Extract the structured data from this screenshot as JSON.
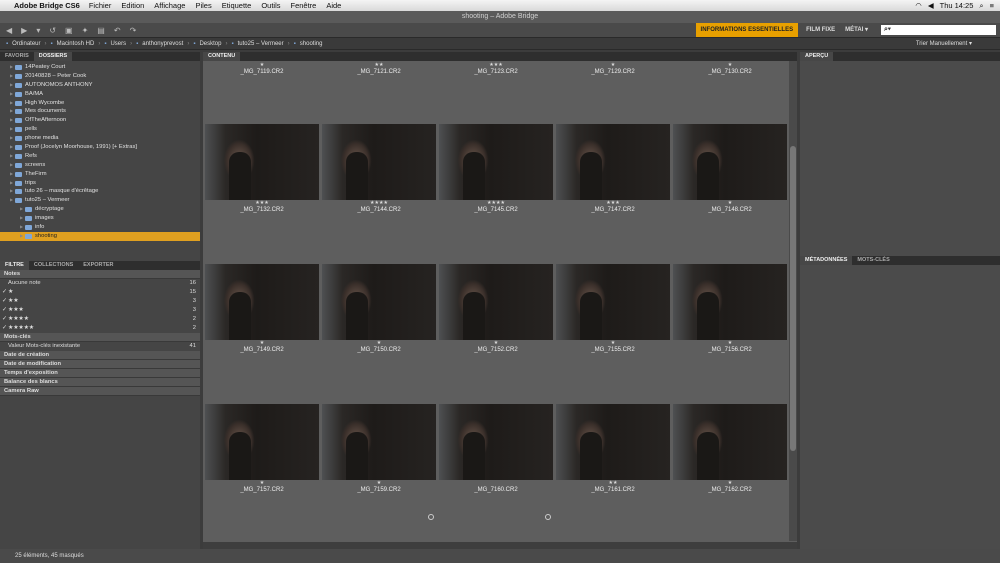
{
  "menubar": {
    "app": "Adobe Bridge CS6",
    "items": [
      "Fichier",
      "Edition",
      "Affichage",
      "Piles",
      "Etiquette",
      "Outils",
      "Fenêtre",
      "Aide"
    ],
    "clock": "Thu 14:25"
  },
  "window": {
    "title": "shooting – Adobe Bridge"
  },
  "workspaces": {
    "active": "INFORMATIONS ESSENTIELLES",
    "film": "FILM FIXE",
    "meta": "MÉTAI ▾",
    "search_placeholder": "⌕▾"
  },
  "path": [
    "Ordinateur",
    "Macintosh HD",
    "Users",
    "anthonyprevost",
    "Desktop",
    "tuto25 – Vermeer",
    "shooting"
  ],
  "sort": "Trier Manuellement ▾",
  "left_tabs": [
    "FAVORIS",
    "DOSSIERS"
  ],
  "folders": [
    {
      "label": "14Peatey Court",
      "depth": 1
    },
    {
      "label": "20140828 – Peter Cook",
      "depth": 1
    },
    {
      "label": "AUTONOMOS ANTHONY",
      "depth": 1
    },
    {
      "label": "BA/MA",
      "depth": 1
    },
    {
      "label": "High Wycombe",
      "depth": 1
    },
    {
      "label": "Mes documents",
      "depth": 1
    },
    {
      "label": "OfTheAfternoon",
      "depth": 1
    },
    {
      "label": "pells",
      "depth": 1
    },
    {
      "label": "phone media",
      "depth": 1
    },
    {
      "label": "Proof (Jocelyn Moorhouse, 1991) [+ Extras]",
      "depth": 1
    },
    {
      "label": "Refs",
      "depth": 1
    },
    {
      "label": "screens",
      "depth": 1
    },
    {
      "label": "TheFirm",
      "depth": 1
    },
    {
      "label": "trips",
      "depth": 1
    },
    {
      "label": "tuto 26 – masque d'écrêtage",
      "depth": 1
    },
    {
      "label": "tuto25 – Vermeer",
      "depth": 1
    },
    {
      "label": "décryptage",
      "depth": 2
    },
    {
      "label": "images",
      "depth": 2
    },
    {
      "label": "info",
      "depth": 2
    },
    {
      "label": "shooting",
      "depth": 2
    }
  ],
  "filter_tabs": [
    "FILTRE",
    "COLLECTIONS",
    "EXPORTER"
  ],
  "filter": {
    "notes_header": "Notes",
    "notes": [
      {
        "label": "Aucune note",
        "count": "16",
        "check": ""
      },
      {
        "label": "★",
        "count": "15",
        "check": "✓"
      },
      {
        "label": "★★",
        "count": "3",
        "check": "✓"
      },
      {
        "label": "★★★",
        "count": "3",
        "check": "✓"
      },
      {
        "label": "★★★★",
        "count": "2",
        "check": "✓"
      },
      {
        "label": "★★★★★",
        "count": "2",
        "check": "✓"
      }
    ],
    "keywords_header": "Mots-clés",
    "keywords": [
      {
        "label": "Valeur Mots-clés inexistante",
        "count": "41"
      }
    ],
    "collapsed": [
      "Date de création",
      "Date de modification",
      "Temps d'exposition",
      "Balance des blancs",
      "Camera Raw"
    ]
  },
  "content_tab": "CONTENU",
  "thumbs_top": [
    {
      "stars": "★",
      "name": "_MG_7119.CR2"
    },
    {
      "stars": "★★",
      "name": "_MG_7121.CR2"
    },
    {
      "stars": "★★★",
      "name": "_MG_7123.CR2"
    },
    {
      "stars": "★",
      "name": "_MG_7129.CR2"
    },
    {
      "stars": "★",
      "name": "_MG_7130.CR2"
    }
  ],
  "thumbs": [
    {
      "stars": "★★★",
      "name": "_MG_7132.CR2"
    },
    {
      "stars": "★★★★",
      "name": "_MG_7144.CR2"
    },
    {
      "stars": "★★★★",
      "name": "_MG_7145.CR2"
    },
    {
      "stars": "★★★",
      "name": "_MG_7147.CR2"
    },
    {
      "stars": "★",
      "name": "_MG_7148.CR2"
    },
    {
      "stars": "★",
      "name": "_MG_7149.CR2"
    },
    {
      "stars": "★",
      "name": "_MG_7150.CR2"
    },
    {
      "stars": "★",
      "name": "_MG_7152.CR2"
    },
    {
      "stars": "★",
      "name": "_MG_7155.CR2"
    },
    {
      "stars": "★",
      "name": "_MG_7156.CR2"
    },
    {
      "stars": "★",
      "name": "_MG_7157.CR2"
    },
    {
      "stars": "★",
      "name": "_MG_7159.CR2"
    },
    {
      "stars": "",
      "name": "_MG_7160.CR2"
    },
    {
      "stars": "★★",
      "name": "_MG_7161.CR2"
    },
    {
      "stars": "★",
      "name": "_MG_7162.CR2"
    }
  ],
  "right_tab": "APERÇU",
  "meta_tabs": [
    "MÉTADONNÉES",
    "MOTS-CLÉS"
  ],
  "status": "25 éléments, 45 masqués"
}
